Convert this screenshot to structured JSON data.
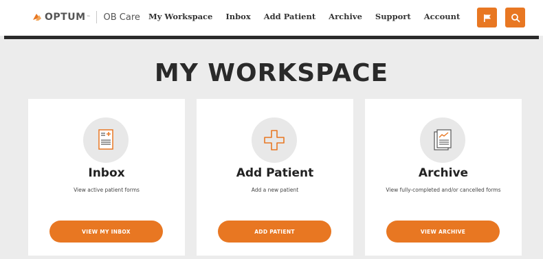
{
  "brand": {
    "logo_word": "OPTUM",
    "logo_tm": "™",
    "product": "OB Care",
    "accent_color": "#e87722"
  },
  "nav": {
    "items": [
      {
        "label": "My Workspace"
      },
      {
        "label": "Inbox"
      },
      {
        "label": "Add Patient"
      },
      {
        "label": "Archive"
      },
      {
        "label": "Support"
      },
      {
        "label": "Account"
      }
    ]
  },
  "header_buttons": [
    {
      "icon": "flag-icon"
    },
    {
      "icon": "search-icon"
    }
  ],
  "page": {
    "title": "MY WORKSPACE"
  },
  "cards": [
    {
      "icon": "inbox-form-icon",
      "title": "Inbox",
      "description": "View active patient forms",
      "button": "VIEW MY INBOX"
    },
    {
      "icon": "add-patient-plus-icon",
      "title": "Add Patient",
      "description": "Add a new patient",
      "button": "ADD PATIENT"
    },
    {
      "icon": "archive-chart-icon",
      "title": "Archive",
      "description": "View fully-completed and/or cancelled forms",
      "button": "VIEW ARCHIVE"
    }
  ]
}
